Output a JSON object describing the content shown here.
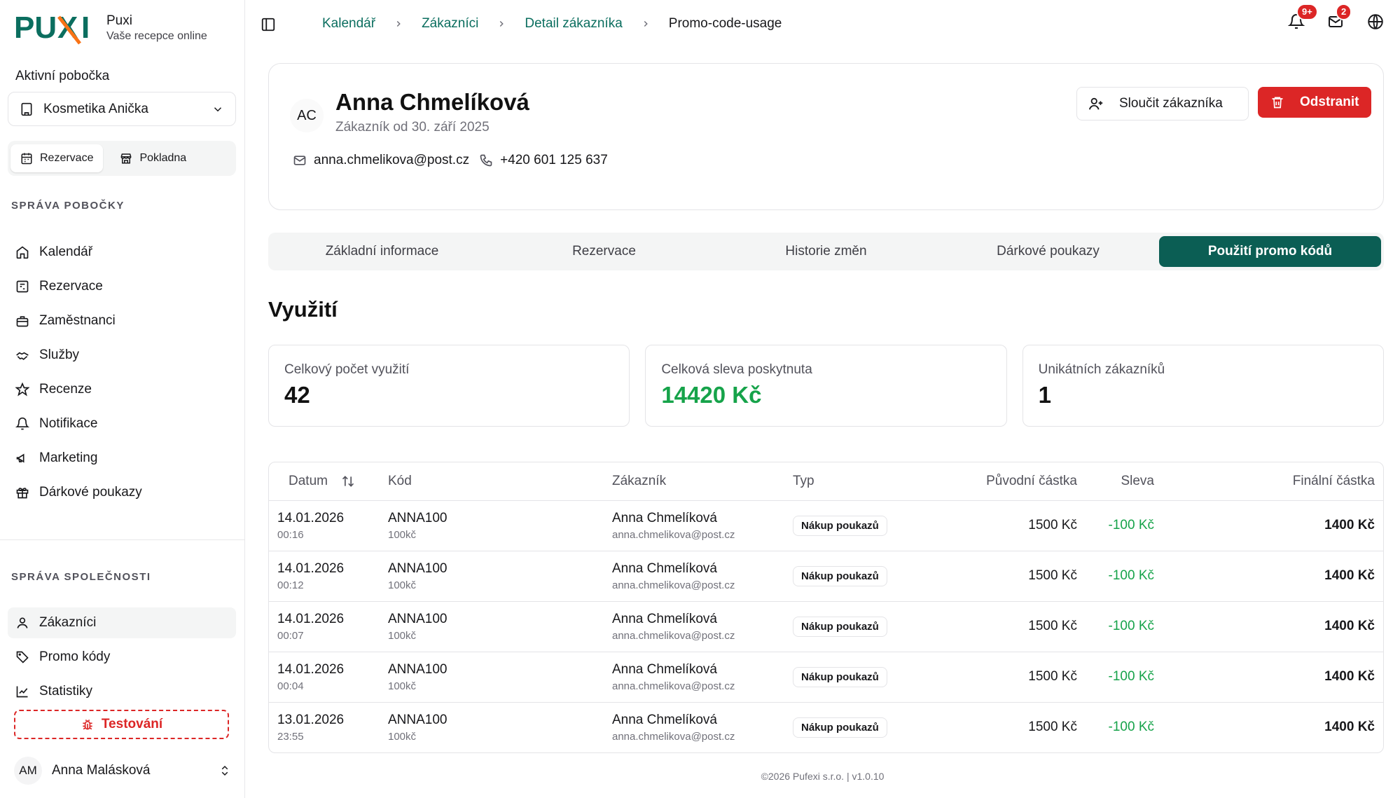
{
  "brand": {
    "name": "Puxi",
    "subtitle": "Vaše recepce online",
    "logo_text": "PUXI",
    "accent_color": "#0b6e5f",
    "logo_x_color": "#f97316"
  },
  "sidebar": {
    "branch_label": "Aktivní pobočka",
    "branch_value": "Kosmetika Anička",
    "quick": [
      {
        "label": "Rezervace",
        "icon": "calendar-icon"
      },
      {
        "label": "Pokladna",
        "icon": "store-icon"
      }
    ],
    "section_branch": "SPRÁVA POBOČKY",
    "branch_items": [
      {
        "label": "Kalendář",
        "icon": "home-icon"
      },
      {
        "label": "Rezervace",
        "icon": "booking-icon"
      },
      {
        "label": "Zaměstnanci",
        "icon": "briefcase-icon"
      },
      {
        "label": "Služby",
        "icon": "handshake-icon"
      },
      {
        "label": "Recenze",
        "icon": "star-icon"
      },
      {
        "label": "Notifikace",
        "icon": "bell-icon"
      },
      {
        "label": "Marketing",
        "icon": "megaphone-icon"
      },
      {
        "label": "Dárkové poukazy",
        "icon": "gift-icon"
      }
    ],
    "section_company": "SPRÁVA SPOLEČNOSTI",
    "company_items": [
      {
        "label": "Zákazníci",
        "icon": "user-icon"
      },
      {
        "label": "Promo kódy",
        "icon": "tag-icon"
      },
      {
        "label": "Statistiky",
        "icon": "chart-icon"
      }
    ],
    "testing_label": "Testování",
    "user": {
      "initials": "AM",
      "name": "Anna Malásková"
    }
  },
  "topbar": {
    "breadcrumb": [
      "Kalendář",
      "Zákazníci",
      "Detail zákazníka"
    ],
    "breadcrumb_current": "Promo-code-usage",
    "notif_badge": "9+",
    "mail_badge": "2"
  },
  "customer": {
    "initials": "AC",
    "name": "Anna Chmelíková",
    "since": "Zákazník od 30. září 2025",
    "email": "anna.chmelikova@post.cz",
    "phone": "+420 601 125 637",
    "merge_label": "Sloučit zákazníka",
    "delete_label": "Odstranit"
  },
  "tabs": [
    {
      "label": "Základní informace",
      "active": false
    },
    {
      "label": "Rezervace",
      "active": false
    },
    {
      "label": "Historie změn",
      "active": false
    },
    {
      "label": "Dárkové poukazy",
      "active": false
    },
    {
      "label": "Použití promo kódů",
      "active": true
    }
  ],
  "usage": {
    "title": "Využití",
    "stats": [
      {
        "label": "Celkový počet využití",
        "value": "42"
      },
      {
        "label": "Celková sleva poskytnuta",
        "value": "14420 Kč"
      },
      {
        "label": "Unikátních zákazníků",
        "value": "1"
      }
    ]
  },
  "table": {
    "headers": {
      "date": "Datum",
      "code": "Kód",
      "customer": "Zákazník",
      "type": "Typ",
      "original": "Původní částka",
      "discount": "Sleva",
      "final": "Finální částka"
    },
    "rows": [
      {
        "date": "14.01.2026",
        "time": "00:16",
        "code": "ANNA100",
        "code_sub": "100kč",
        "customer": "Anna Chmelíková",
        "email": "anna.chmelikova@post.cz",
        "type": "Nákup poukazů",
        "original": "1500 Kč",
        "discount": "-100 Kč",
        "final": "1400 Kč"
      },
      {
        "date": "14.01.2026",
        "time": "00:12",
        "code": "ANNA100",
        "code_sub": "100kč",
        "customer": "Anna Chmelíková",
        "email": "anna.chmelikova@post.cz",
        "type": "Nákup poukazů",
        "original": "1500 Kč",
        "discount": "-100 Kč",
        "final": "1400 Kč"
      },
      {
        "date": "14.01.2026",
        "time": "00:07",
        "code": "ANNA100",
        "code_sub": "100kč",
        "customer": "Anna Chmelíková",
        "email": "anna.chmelikova@post.cz",
        "type": "Nákup poukazů",
        "original": "1500 Kč",
        "discount": "-100 Kč",
        "final": "1400 Kč"
      },
      {
        "date": "14.01.2026",
        "time": "00:04",
        "code": "ANNA100",
        "code_sub": "100kč",
        "customer": "Anna Chmelíková",
        "email": "anna.chmelikova@post.cz",
        "type": "Nákup poukazů",
        "original": "1500 Kč",
        "discount": "-100 Kč",
        "final": "1400 Kč"
      },
      {
        "date": "13.01.2026",
        "time": "23:55",
        "code": "ANNA100",
        "code_sub": "100kč",
        "customer": "Anna Chmelíková",
        "email": "anna.chmelikova@post.cz",
        "type": "Nákup poukazů",
        "original": "1500 Kč",
        "discount": "-100 Kč",
        "final": "1400 Kč"
      }
    ]
  },
  "footer": "©2026 Pufexi s.r.o.  |  v1.0.10"
}
